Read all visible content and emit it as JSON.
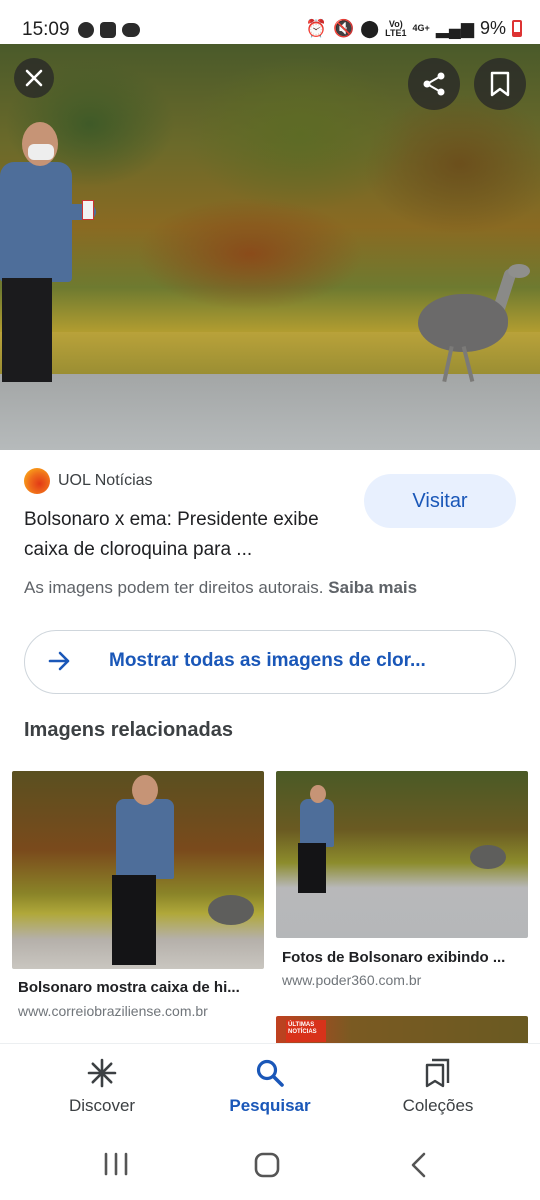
{
  "status_bar": {
    "time": "15:09",
    "battery": "9%",
    "network_top": "Vo)",
    "network_bottom": "LTE1",
    "network_gen": "4G+"
  },
  "image_viewer": {
    "close_icon": "close-icon",
    "share_icon": "share-icon",
    "bookmark_icon": "bookmark-icon"
  },
  "result": {
    "source_name": "UOL Notícias",
    "visit_label": "Visitar",
    "title": "Bolsonaro x ema: Presidente exibe caixa de cloroquina para ...",
    "rights_text": "As imagens podem ter direitos autorais.",
    "rights_link": "Saiba mais"
  },
  "show_all": {
    "label": "Mostrar todas as imagens de clor..."
  },
  "related": {
    "heading": "Imagens relacionadas",
    "items": [
      {
        "caption": "Bolsonaro mostra caixa de hi...",
        "domain": "www.correiobraziliense.com.br"
      },
      {
        "caption": "Fotos de Bolsonaro exibindo ...",
        "domain": "www.poder360.com.br"
      },
      {
        "caption": "",
        "domain": ""
      }
    ],
    "badge_text": "ÚLTIMAS NOTÍCIAS"
  },
  "bottom_nav": {
    "items": [
      {
        "label": "Discover",
        "icon": "asterisk-icon",
        "active": false
      },
      {
        "label": "Pesquisar",
        "icon": "search-icon",
        "active": true
      },
      {
        "label": "Coleções",
        "icon": "collections-icon",
        "active": false
      }
    ]
  },
  "system_nav": {
    "recents_icon": "recents-icon",
    "home_icon": "home-icon",
    "back_icon": "back-icon"
  },
  "colors": {
    "accent": "#1a57b8",
    "visit_bg": "#e8f0fe",
    "battery_low": "#dd3333"
  }
}
